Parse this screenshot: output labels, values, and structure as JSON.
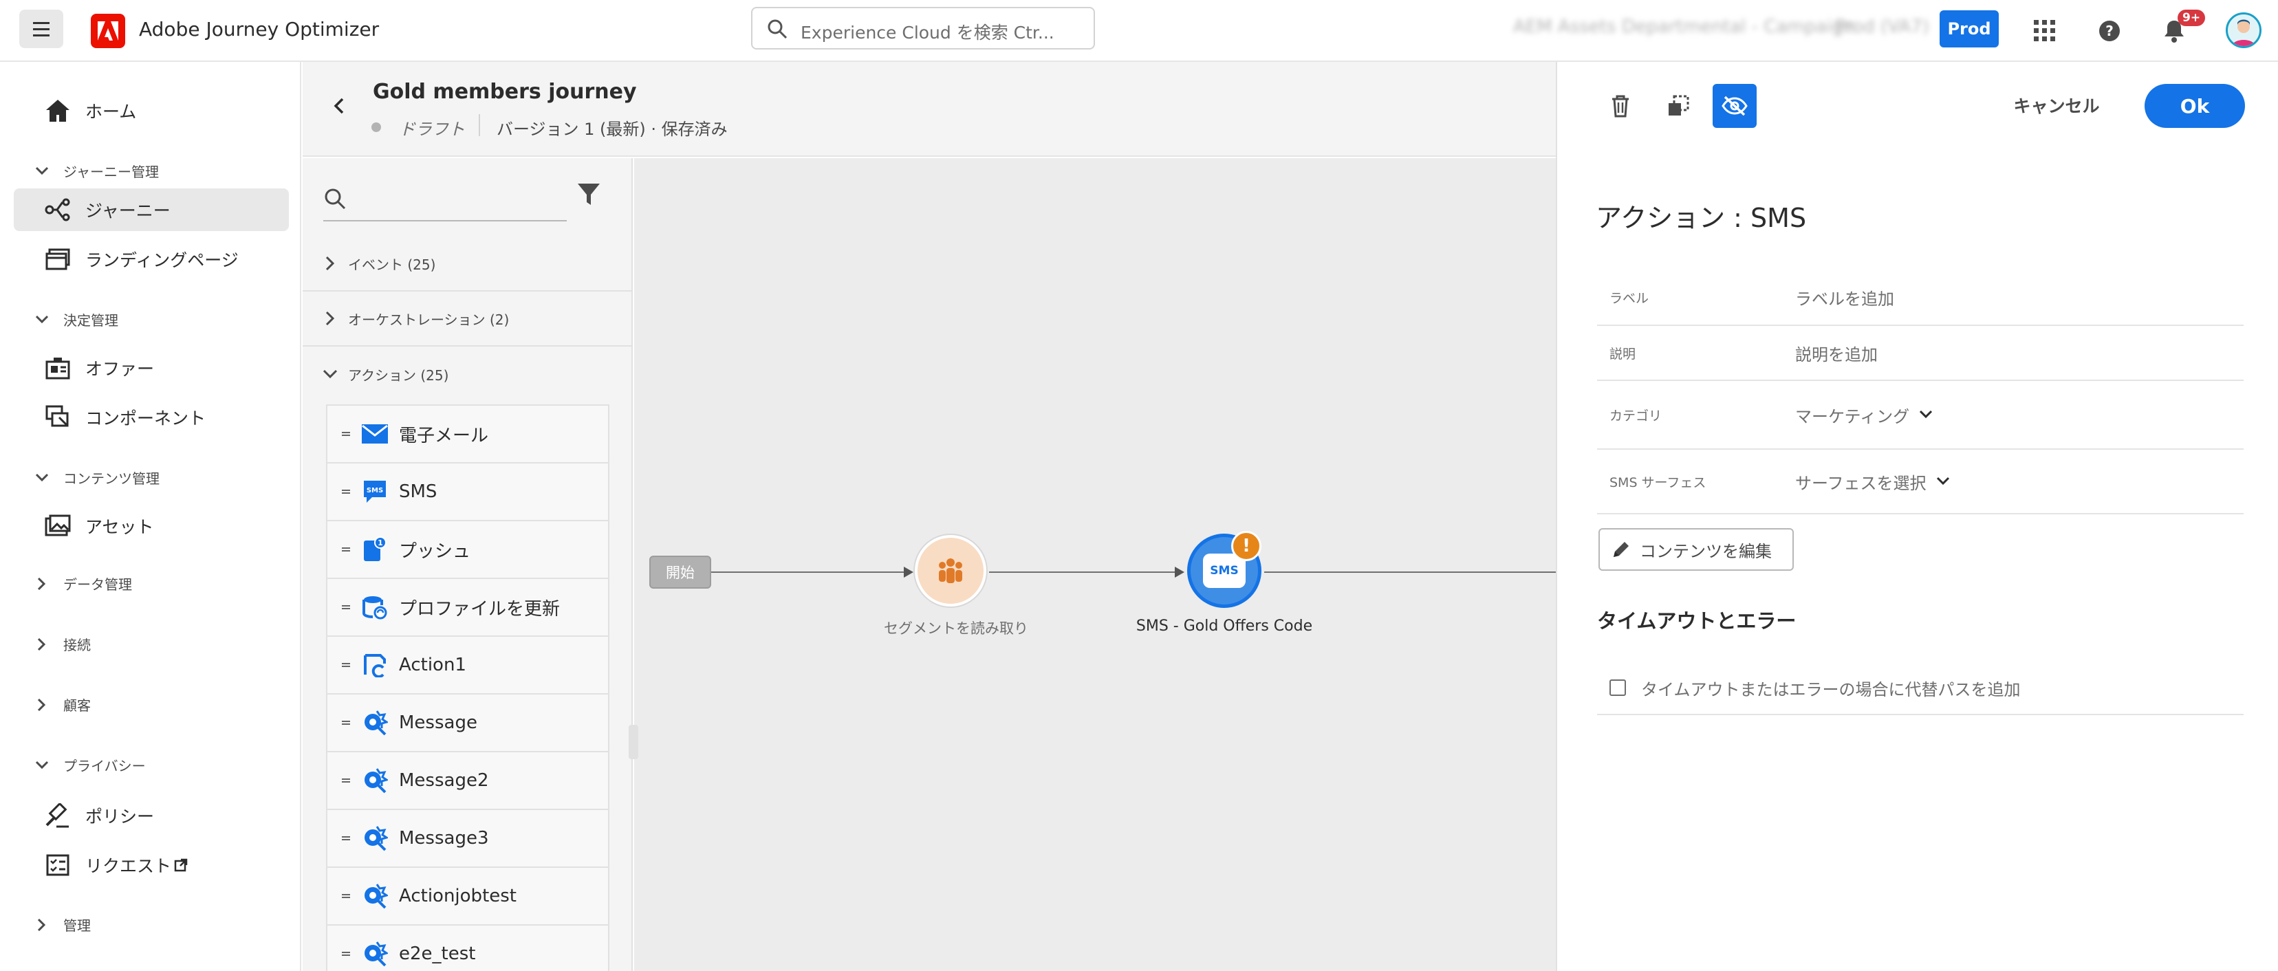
{
  "app": {
    "title": "Adobe Journey Optimizer"
  },
  "search": {
    "placeholder": "Experience Cloud を検索  Ctr..."
  },
  "org": {
    "name": "AEM Assets Departmental - Campaign",
    "sandbox": "Prod (VA7)"
  },
  "env_button": "Prod",
  "notifications": {
    "count": "9+"
  },
  "nav": {
    "home": "ホーム",
    "group_journey": "ジャーニー管理",
    "journeys": "ジャーニー",
    "landing": "ランディングページ",
    "group_decision": "決定管理",
    "offers": "オファー",
    "components": "コンポーネント",
    "group_content": "コンテンツ管理",
    "assets": "アセット",
    "group_data": "データ管理",
    "group_connections": "接続",
    "group_customers": "顧客",
    "group_privacy": "プライバシー",
    "policies": "ポリシー",
    "requests": "リクエスト",
    "group_admin": "管理"
  },
  "journey": {
    "title": "Gold members journey",
    "status": "ドラフト",
    "version": "バージョン 1 (最新) · 保存済み"
  },
  "palette": {
    "events": "イベント (25)",
    "orchestration": "オーケストレーション (2)",
    "actions": "アクション (25)",
    "items": [
      {
        "label": "電子メール",
        "icon": "email-icon"
      },
      {
        "label": "SMS",
        "icon": "sms-icon"
      },
      {
        "label": "プッシュ",
        "icon": "push-icon"
      },
      {
        "label": "プロファイルを更新",
        "icon": "update-profile-icon"
      },
      {
        "label": "Action1",
        "icon": "custom-action-icon"
      },
      {
        "label": "Message",
        "icon": "message-icon"
      },
      {
        "label": "Message2",
        "icon": "message-icon"
      },
      {
        "label": "Message3",
        "icon": "message-icon"
      },
      {
        "label": "Actionjobtest",
        "icon": "message-icon"
      },
      {
        "label": "e2e_test",
        "icon": "message-icon"
      }
    ]
  },
  "canvas": {
    "start": "開始",
    "segment_label": "セグメントを読み取り",
    "sms_label": "SMS - Gold Offers Code",
    "sms_icon_text": "SMS"
  },
  "panel": {
    "cancel": "キャンセル",
    "ok": "Ok",
    "title": "アクション : SMS",
    "label_key": "ラベル",
    "label_value": "ラベルを追加",
    "desc_key": "説明",
    "desc_value": "説明を追加",
    "category_key": "カテゴリ",
    "category_value": "マーケティング",
    "surface_key": "SMS サーフェス",
    "surface_value": "サーフェスを選択",
    "edit_content": "コンテンツを編集",
    "timeout_title": "タイムアウトとエラー",
    "timeout_checkbox": "タイムアウトまたはエラーの場合に代替パスを追加"
  },
  "colors": {
    "accent": "#1473e6",
    "brand": "#eb1000",
    "warning": "#e68619",
    "segment": "#f8dcc4"
  }
}
